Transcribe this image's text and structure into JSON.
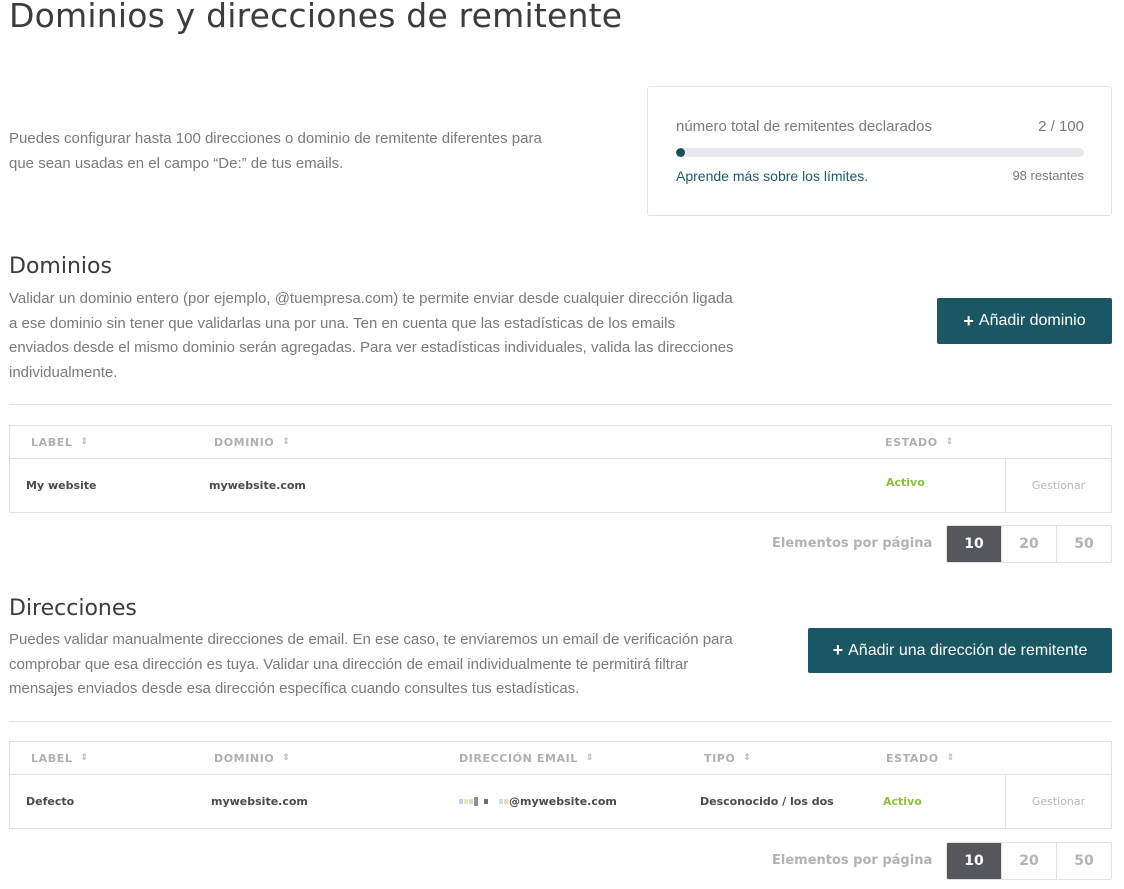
{
  "page": {
    "title": "Dominios y direcciones de remitente",
    "intro": "Puedes configurar hasta 100 direcciones o dominio de remitente diferentes para que sean usadas en el campo “De:” de tus emails."
  },
  "limits": {
    "label": "número total de remitentes declarados",
    "count": "2 / 100",
    "used": 2,
    "max": 100,
    "link": "Aprende más sobre los límites.",
    "remaining": "98 restantes"
  },
  "domains": {
    "title": "Dominios",
    "description": "Validar un dominio entero (por ejemplo, @tuempresa.com) te permite enviar desde cualquier dirección ligada a ese dominio sin tener que validarlas una por una. Ten en cuenta que las estadísticas de los emails enviados desde el mismo dominio serán agregadas. Para ver estadísticas individuales, valida las direcciones individualmente.",
    "add_button": {
      "icon": "plus-icon",
      "label": "Añadir dominio"
    },
    "columns": [
      "LABEL",
      "DOMINIO",
      "ESTADO"
    ],
    "rows": [
      {
        "label": "My website",
        "domain": "mywebsite.com",
        "status": "Activo",
        "action": "Gestionar"
      }
    ],
    "pagination": {
      "label": "Elementos por página",
      "options": [
        "10",
        "20",
        "50"
      ],
      "selected": "10"
    }
  },
  "addresses": {
    "title": "Direcciones",
    "description": "Puedes validar manualmente direcciones de email. En ese caso, te enviaremos un email de verificación para comprobar que esa dirección es tuya. Validar una dirección de email individualmente te permitirá filtrar mensajes enviados desde esa dirección específica cuando consultes tus estadísticas.",
    "add_button": {
      "icon": "plus-icon",
      "label": "Añadir una dirección de remitente"
    },
    "columns": [
      "LABEL",
      "DOMINIO",
      "DIRECCIÓN EMAIL",
      "TIPO",
      "ESTADO"
    ],
    "rows": [
      {
        "label": "Defecto",
        "domain": "mywebsite.com",
        "email_suffix": "@mywebsite.com",
        "type": "Desconocido / los dos",
        "status": "Activo",
        "action": "Gestionar"
      }
    ],
    "pagination": {
      "label": "Elementos por página",
      "options": [
        "10",
        "20",
        "50"
      ],
      "selected": "10"
    }
  },
  "colors": {
    "primary": "#1b5663",
    "active_status": "#8cc03e",
    "link": "#1b5c6b",
    "pager_active": "#56575c"
  }
}
